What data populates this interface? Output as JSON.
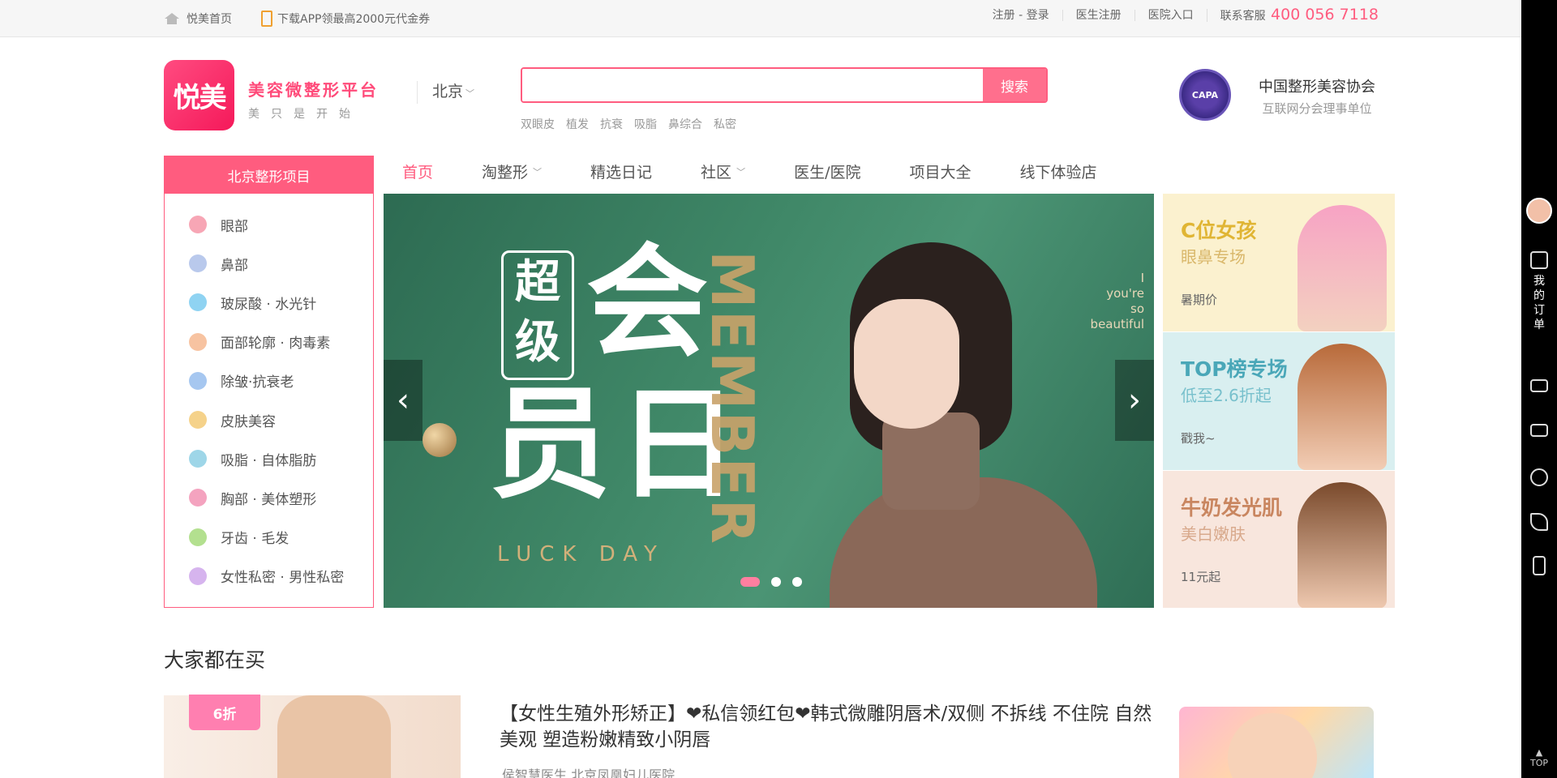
{
  "topbar": {
    "home": "悦美首页",
    "app_promo": "下载APP领最高2000元代金券",
    "register_login": "注册 - 登录",
    "doctor_register": "医生注册",
    "hospital_entry": "医院入口",
    "service_label": "联系客服",
    "hotline": "400 056 7118"
  },
  "header": {
    "logo_text": "悦美",
    "slogan_main": "美容微整形平台",
    "slogan_sub": "美只是开始",
    "city": "北京",
    "search": {
      "value": "",
      "button": "搜索"
    },
    "hot_words": [
      "双眼皮",
      "植发",
      "抗衰",
      "吸脂",
      "鼻综合",
      "私密"
    ],
    "association": {
      "badge": "CAPA",
      "name": "中国整形美容协会",
      "sub": "互联网分会理事单位"
    }
  },
  "category": {
    "title": "北京整形项目",
    "items": [
      {
        "label": "眼部",
        "color": "#f7a6b5"
      },
      {
        "label": "鼻部",
        "color": "#b9c9ec"
      },
      {
        "label": "玻尿酸 · 水光针",
        "color": "#8fd3f2"
      },
      {
        "label": "面部轮廓 · 肉毒素",
        "color": "#f7c3a1"
      },
      {
        "label": "除皱·抗衰老",
        "color": "#a6c7f0"
      },
      {
        "label": "皮肤美容",
        "color": "#f5d28a"
      },
      {
        "label": "吸脂 · 自体脂肪",
        "color": "#9ed6e8"
      },
      {
        "label": "胸部 · 美体塑形",
        "color": "#f4a3bf"
      },
      {
        "label": "牙齿 · 毛发",
        "color": "#b3e08f"
      },
      {
        "label": "女性私密 · 男性私密",
        "color": "#d6b4ee"
      }
    ]
  },
  "nav": {
    "items": [
      {
        "label": "首页",
        "dropdown": false
      },
      {
        "label": "淘整形",
        "dropdown": true
      },
      {
        "label": "精选日记",
        "dropdown": false
      },
      {
        "label": "社区",
        "dropdown": true
      },
      {
        "label": "医生/医院",
        "dropdown": false
      },
      {
        "label": "项目大全",
        "dropdown": false
      },
      {
        "label": "线下体验店",
        "dropdown": false
      }
    ],
    "active_index": 0
  },
  "banner": {
    "box_chars": "超级",
    "big_top": "会",
    "big_bottom": "员日",
    "vertical": "MEMBER",
    "footer": "LUCK DAY",
    "eng_lines": [
      "I",
      "you're",
      "so",
      "beautiful"
    ],
    "prev": "‹",
    "next": "›",
    "slide_count": 3,
    "active_slide": 0
  },
  "promos": [
    {
      "title": "C位女孩",
      "sub": "眼鼻专场",
      "note": "暑期价"
    },
    {
      "title": "TOP榜专场",
      "sub": "低至2.6折起",
      "note": "戳我~"
    },
    {
      "title": "牛奶发光肌",
      "sub": "美白嫩肤",
      "note": "11元起"
    }
  ],
  "section": {
    "title": "大家都在买",
    "product": {
      "discount": "6折",
      "title": "【女性生殖外形矫正】❤私信领红包❤韩式微雕阴唇术/双侧 不拆线 不住院 自然美观 塑造粉嫩精致小阴唇",
      "doctor": "侯智慧医生",
      "hospital": "北京凤凰妇儿医院"
    }
  },
  "sidebar_tools": {
    "order_label": "我的订单",
    "top_label": "TOP"
  }
}
